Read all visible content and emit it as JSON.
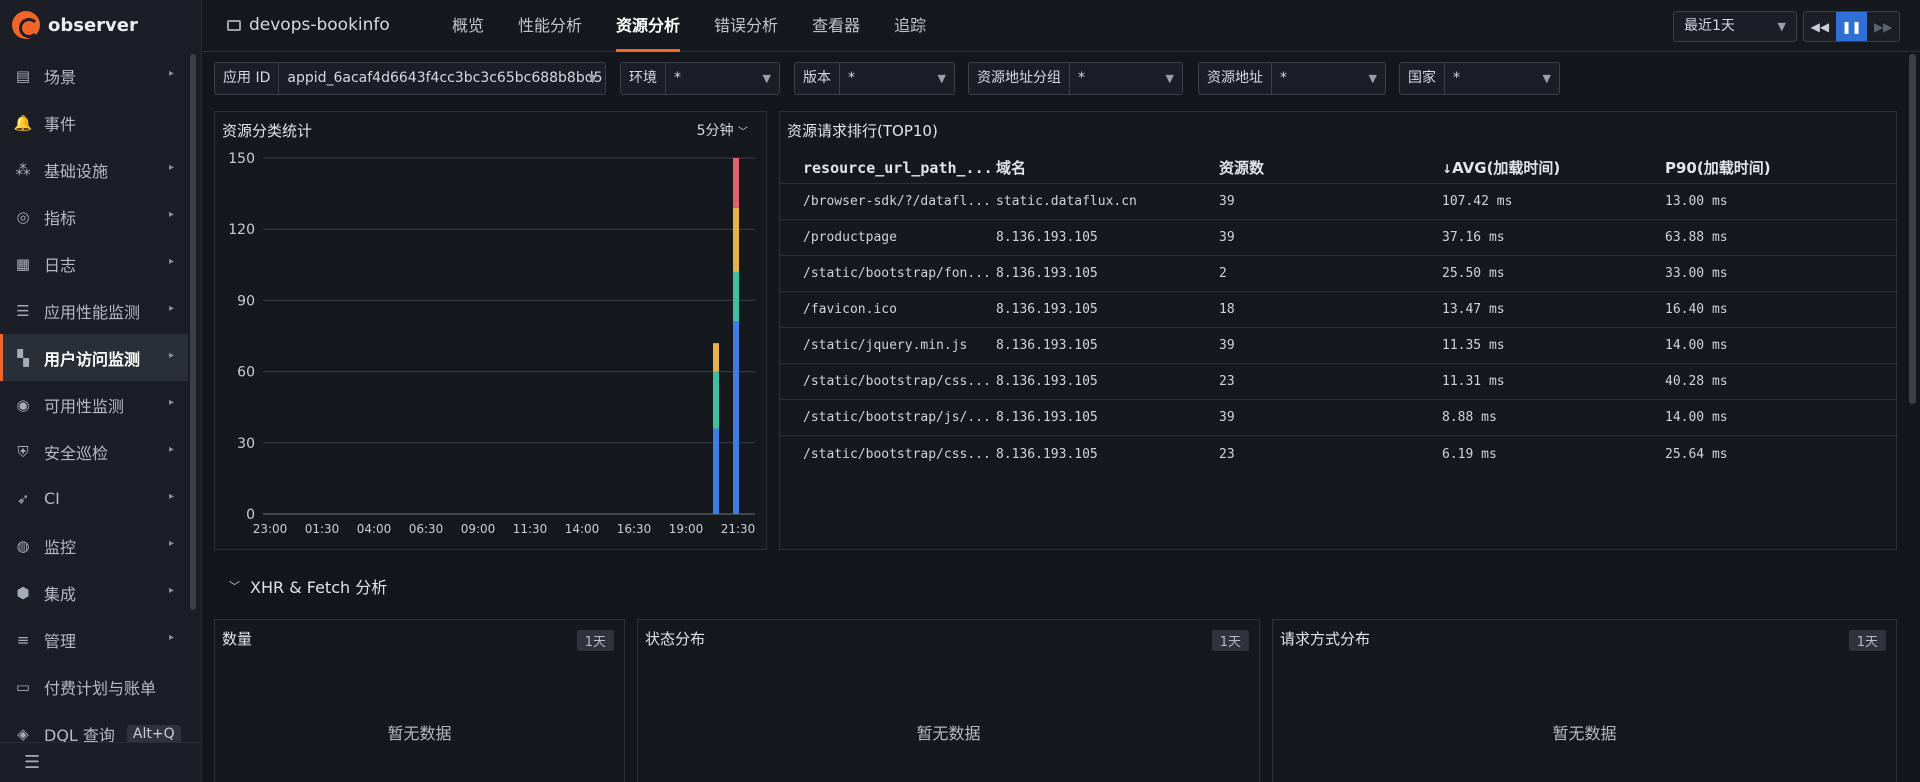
{
  "logo": {
    "text": "observer"
  },
  "sidebar": {
    "items": [
      {
        "label": "场景",
        "icon": "chart-icon",
        "arrow": true,
        "active": false
      },
      {
        "label": "事件",
        "icon": "bell-icon",
        "arrow": false,
        "active": false
      },
      {
        "label": "基础设施",
        "icon": "infrastructure-icon",
        "arrow": true,
        "active": false
      },
      {
        "label": "指标",
        "icon": "metric-icon",
        "arrow": true,
        "active": false
      },
      {
        "label": "日志",
        "icon": "log-icon",
        "arrow": true,
        "active": false
      },
      {
        "label": "应用性能监测",
        "icon": "apm-icon",
        "arrow": true,
        "active": false
      },
      {
        "label": "用户访问监测",
        "icon": "rum-icon",
        "arrow": true,
        "active": true
      },
      {
        "label": "可用性监测",
        "icon": "availability-icon",
        "arrow": true,
        "active": false
      },
      {
        "label": "安全巡检",
        "icon": "shield-icon",
        "arrow": true,
        "active": false
      },
      {
        "label": "CI",
        "icon": "rocket-icon",
        "arrow": true,
        "active": false
      },
      {
        "label": "监控",
        "icon": "monitor-icon",
        "arrow": true,
        "active": false
      },
      {
        "label": "集成",
        "icon": "cube-icon",
        "arrow": true,
        "active": false
      },
      {
        "label": "管理",
        "icon": "settings-icon",
        "arrow": true,
        "active": false
      },
      {
        "label": "付费计划与账单",
        "icon": "billing-icon",
        "arrow": false,
        "active": false
      },
      {
        "label": "DQL 查询",
        "icon": "compass-icon",
        "arrow": false,
        "active": false,
        "shortcut": "Alt+Q"
      }
    ]
  },
  "header": {
    "project": "devops-bookinfo",
    "tabs": [
      "概览",
      "性能分析",
      "资源分析",
      "错误分析",
      "查看器",
      "追踪"
    ],
    "active_tab": 2,
    "time_range": "最近1天"
  },
  "filters": [
    {
      "label": "应用 ID",
      "value": "appid_6acaf4d6643f4cc3bc3c65bc688b8bd5"
    },
    {
      "label": "环境",
      "value": "*"
    },
    {
      "label": "版本",
      "value": "*"
    },
    {
      "label": "资源地址分组",
      "value": "*"
    },
    {
      "label": "资源地址",
      "value": "*"
    },
    {
      "label": "国家",
      "value": "*"
    }
  ],
  "resource_chart": {
    "title": "资源分类统计",
    "interval": "5分钟"
  },
  "chart_data": {
    "type": "bar",
    "stacked": true,
    "x_tick_labels": [
      "23:00",
      "01:30",
      "04:00",
      "06:30",
      "09:00",
      "11:30",
      "14:00",
      "16:30",
      "19:00",
      "21:30"
    ],
    "ylim": [
      0,
      150
    ],
    "y_ticks": [
      0,
      30,
      60,
      90,
      120,
      150
    ],
    "grid": true,
    "colors": [
      "#3d7ee6",
      "#3fbfa2",
      "#e8b14a",
      "#e0606e"
    ],
    "bars": [
      {
        "x": "~21:10",
        "stack": [
          36,
          24,
          12
        ]
      },
      {
        "x": "~21:55",
        "stack": [
          81,
          21,
          27,
          21
        ]
      }
    ]
  },
  "ranking": {
    "title": "资源请求排行(TOP10)",
    "columns": [
      "resource_url_path_...",
      "域名",
      "资源数",
      "AVG(加载时间)",
      "P90(加载时间)"
    ],
    "rows": [
      [
        "/browser-sdk/?/datafl...",
        "static.dataflux.cn",
        "39",
        "107.42 ms",
        "13.00 ms"
      ],
      [
        "/productpage",
        "8.136.193.105",
        "39",
        "37.16 ms",
        "63.88 ms"
      ],
      [
        "/static/bootstrap/fon...",
        "8.136.193.105",
        "2",
        "25.50 ms",
        "33.00 ms"
      ],
      [
        "/favicon.ico",
        "8.136.193.105",
        "18",
        "13.47 ms",
        "16.40 ms"
      ],
      [
        "/static/jquery.min.js",
        "8.136.193.105",
        "39",
        "11.35 ms",
        "14.00 ms"
      ],
      [
        "/static/bootstrap/css...",
        "8.136.193.105",
        "23",
        "11.31 ms",
        "40.28 ms"
      ],
      [
        "/static/bootstrap/js/...",
        "8.136.193.105",
        "39",
        "8.88 ms",
        "14.00 ms"
      ],
      [
        "/static/bootstrap/css...",
        "8.136.193.105",
        "23",
        "6.19 ms",
        "25.64 ms"
      ]
    ]
  },
  "xhr_section": {
    "title": "XHR & Fetch 分析"
  },
  "xhr_panels": [
    {
      "title": "数量",
      "badge": "1天",
      "empty": "暂无数据"
    },
    {
      "title": "状态分布",
      "badge": "1天",
      "empty": "暂无数据"
    },
    {
      "title": "请求方式分布",
      "badge": "1天",
      "empty": "暂无数据"
    }
  ],
  "colors": {
    "accent": "#f0662a",
    "active_blue": "#2f6fd6"
  }
}
